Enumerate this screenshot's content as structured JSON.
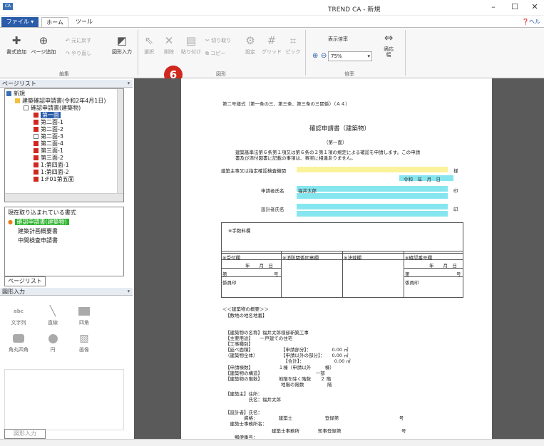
{
  "window": {
    "icon": "CA",
    "title": "TREND CA - 新規",
    "minimize": "–",
    "maximize": "☐",
    "close": "✕"
  },
  "tabs": {
    "file": "ファイル ▾",
    "home": "ホーム",
    "tool": "ツール",
    "help": "ヘル"
  },
  "ribbon": {
    "add_format": "書式追加",
    "add_page": "ページ追加",
    "undo": "元に戻す",
    "redo": "やり直し",
    "shape_input": "図形入力",
    "select": "選択",
    "delete": "削除",
    "paste": "貼り付け",
    "cut": "切り取り",
    "copy": "コピー",
    "settings": "設定",
    "grid": "グリッド",
    "snap": "ピック",
    "zoom_label": "表示倍率",
    "zoom_value": "75%",
    "fit_width": "適応",
    "fit_height": "幅",
    "group_edit": "編集",
    "group_shape": "図形",
    "group_zoom": "倍率"
  },
  "badge": "6",
  "page_list": {
    "title": "ページリスト",
    "pin": "ᵠ",
    "items": [
      {
        "label": "新規"
      },
      {
        "label": "建築確認申請書(令和2年4月1日)"
      },
      {
        "label": "確認申請書(建築物)"
      },
      {
        "label": "第一面"
      },
      {
        "label": "第二面-1"
      },
      {
        "label": "第二面-2"
      },
      {
        "label": "第二面-3"
      },
      {
        "label": "第二面-4"
      },
      {
        "label": "第三面-1"
      },
      {
        "label": "第三面-2"
      },
      {
        "label": "1:第四面-1"
      },
      {
        "label": "1:第四面-2"
      },
      {
        "label": "1:F01第五面"
      }
    ]
  },
  "loaded_formats": {
    "title": "現在取り込まれている書式",
    "items": [
      {
        "label": "確認申請書(建築物)"
      },
      {
        "label": "建築計画概要書"
      },
      {
        "label": "中間検査申請書"
      }
    ],
    "tab": "ページリスト"
  },
  "shape_panel": {
    "title": "図形入力",
    "pin": "ᵠ",
    "items": [
      {
        "label": "文字列",
        "icon": "abc-text-icon"
      },
      {
        "label": "直線",
        "icon": "line-icon"
      },
      {
        "label": "四角",
        "icon": "rect-icon"
      },
      {
        "label": "角丸四角",
        "icon": "rounded-rect-icon"
      },
      {
        "label": "円",
        "icon": "circle-icon"
      },
      {
        "label": "画像",
        "icon": "image-icon"
      }
    ],
    "tab": "図形入力"
  },
  "document": {
    "header": "第二号様式（第一条の三、第三条、第三条の三関係）（Ａ４）",
    "title": "確認申請書（建築物）",
    "subtitle": "（第一面）",
    "intro1": "建築基準法第６条第１項又は第６条の２第１項の規定による確認を申請します。この申請",
    "intro2": "書及び添付図書に記載の事項は、事実に相違ありません。",
    "addressee": "建築主事又は指定確認検査機関",
    "sama": "様",
    "date": "令和　年　月　日",
    "applicant_label": "申請者氏名",
    "applicant_name": "福井太郎",
    "seal1": "印",
    "designer_label": "設計者氏名",
    "seal2": "印",
    "fee_label": "※手数料欄",
    "col1": "※受付欄",
    "col2": "※消防関係同意欄",
    "col3": "※決裁欄",
    "col4": "※確認番号欄",
    "ymd1": "年　　月　日",
    "ymd2": "年　　月　日",
    "no1": "第",
    "go1": "号",
    "no2": "第",
    "go2": "号",
    "staff1": "係員印",
    "staff2": "係員印",
    "outline1": "＜＜建築物の概要＞＞",
    "outline2": "【敷地の地名地番】",
    "l1": "【建築物の名称】福井太郎様邸新築工事",
    "l2": "【主要用途】　　一戸建ての住宅",
    "l3": "【工事種別】",
    "l4": "【延べ面積】　　　　　　　【申請部分】：　　　　　0.00 ㎡",
    "l5": "（建築物全体）　　　　　　【申請以外の部分】：　　0.00 ㎡",
    "l6": "　　　　　　　　　　　　　【合計】：　　　　　　　0.00 ㎡",
    "l7": "【申請棟数】　　　　　　１棟（申請以外　　　棟）",
    "l8": "【建築物の構造】　　　　　　　　　　　　一部",
    "l9": "【建築物の階数】　　　　地階を除く階数　　２ 階",
    "l10": "　　　　　　　　　　　　地階の階数　　　　　階",
    "l11": "【建築主】住所：",
    "l12": "　　　　　氏名：福井太郎",
    "l13": "【設計者】氏名：",
    "l14": "　　　　資格：　　　　　建築士　　　　　　　登録第　　　　　　　　　　　　　号",
    "l15": "　建築士事務所名：",
    "l16": "　　　　　　　　　　建築士事務所　　　　知事登録第　　　　　　　　　　　　　号",
    "l17": "　　郵便番号："
  }
}
